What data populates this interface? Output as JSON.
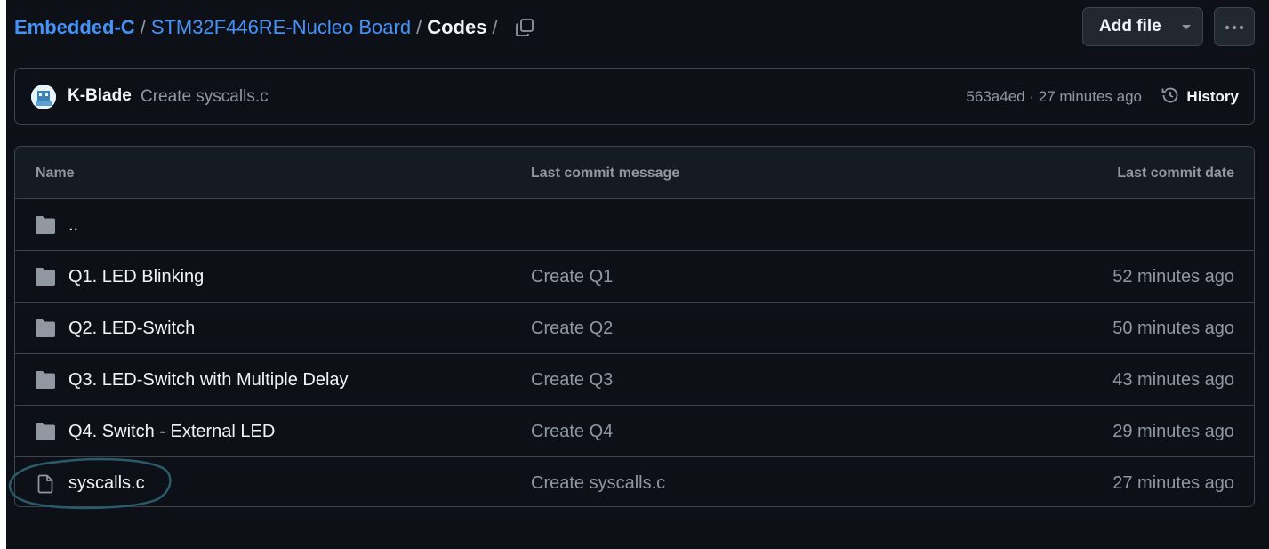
{
  "breadcrumb": {
    "repo": "Embedded-C",
    "folder": "STM32F446RE-Nucleo Board",
    "current": "Codes",
    "separator": "/"
  },
  "toolbar": {
    "add_file_label": "Add file",
    "more_icon": "kebab-horizontal-icon"
  },
  "latest_commit": {
    "author": "K-Blade",
    "message": "Create syscalls.c",
    "sha": "563a4ed",
    "dot": "·",
    "time": "27 minutes ago",
    "history_label": "History"
  },
  "table": {
    "headers": {
      "name": "Name",
      "message": "Last commit message",
      "date": "Last commit date"
    },
    "rows": [
      {
        "type": "folder",
        "name": "..",
        "message": "",
        "date": ""
      },
      {
        "type": "folder",
        "name": "Q1. LED Blinking",
        "message": "Create Q1",
        "date": "52 minutes ago"
      },
      {
        "type": "folder",
        "name": "Q2. LED-Switch",
        "message": "Create Q2",
        "date": "50 minutes ago"
      },
      {
        "type": "folder",
        "name": "Q3. LED-Switch with Multiple Delay",
        "message": "Create Q3",
        "date": "43 minutes ago"
      },
      {
        "type": "folder",
        "name": "Q4. Switch - External LED",
        "message": "Create Q4",
        "date": "29 minutes ago"
      },
      {
        "type": "file",
        "name": "syscalls.c",
        "message": "Create syscalls.c",
        "date": "27 minutes ago"
      }
    ]
  },
  "colors": {
    "background": "#0d1117",
    "link": "#4493f8",
    "muted": "#9198a1",
    "border": "#3d444d",
    "annotation": "#2b5a6b"
  }
}
